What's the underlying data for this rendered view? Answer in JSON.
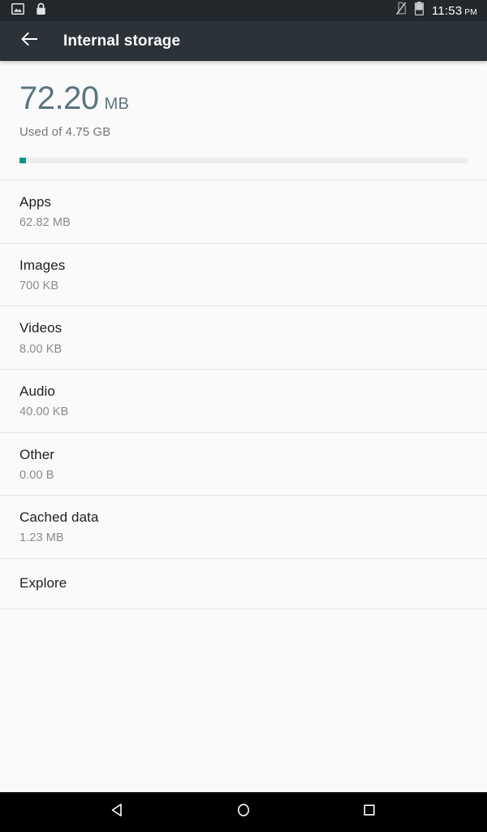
{
  "status_bar": {
    "left_icons": [
      {
        "name": "screenshot-image-icon"
      },
      {
        "name": "lock-icon"
      }
    ],
    "right_icons": [
      {
        "name": "no-sim-icon"
      },
      {
        "name": "battery-icon"
      }
    ],
    "time": "11:53",
    "meridiem": "PM"
  },
  "toolbar": {
    "back_icon": "back-arrow-icon",
    "title": "Internal storage"
  },
  "summary": {
    "value": "72.20",
    "unit": "MB",
    "caption": "Used of 4.75 GB",
    "progress_percent": 1.5,
    "progress_color": "#0f9289",
    "track_color": "#eceded",
    "value_color": "#5d7480"
  },
  "list": [
    {
      "title": "Apps",
      "subtitle": "62.82 MB"
    },
    {
      "title": "Images",
      "subtitle": "700 KB"
    },
    {
      "title": "Videos",
      "subtitle": "8.00 KB"
    },
    {
      "title": "Audio",
      "subtitle": "40.00 KB"
    },
    {
      "title": "Other",
      "subtitle": "0.00 B"
    },
    {
      "title": "Cached data",
      "subtitle": "1.23 MB"
    },
    {
      "title": "Explore",
      "subtitle": ""
    }
  ],
  "nav_bar": {
    "back": "back-triangle-icon",
    "home": "home-circle-icon",
    "recents": "recents-square-icon"
  }
}
